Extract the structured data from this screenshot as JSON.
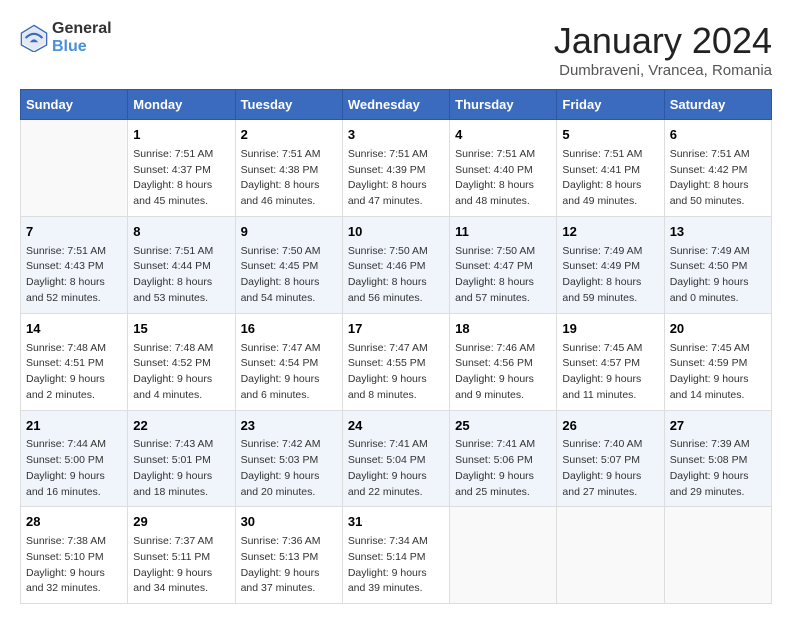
{
  "logo": {
    "text_general": "General",
    "text_blue": "Blue"
  },
  "title": "January 2024",
  "subtitle": "Dumbraveni, Vrancea, Romania",
  "days_of_week": [
    "Sunday",
    "Monday",
    "Tuesday",
    "Wednesday",
    "Thursday",
    "Friday",
    "Saturday"
  ],
  "weeks": [
    [
      {
        "day": "",
        "info": ""
      },
      {
        "day": "1",
        "info": "Sunrise: 7:51 AM\nSunset: 4:37 PM\nDaylight: 8 hours\nand 45 minutes."
      },
      {
        "day": "2",
        "info": "Sunrise: 7:51 AM\nSunset: 4:38 PM\nDaylight: 8 hours\nand 46 minutes."
      },
      {
        "day": "3",
        "info": "Sunrise: 7:51 AM\nSunset: 4:39 PM\nDaylight: 8 hours\nand 47 minutes."
      },
      {
        "day": "4",
        "info": "Sunrise: 7:51 AM\nSunset: 4:40 PM\nDaylight: 8 hours\nand 48 minutes."
      },
      {
        "day": "5",
        "info": "Sunrise: 7:51 AM\nSunset: 4:41 PM\nDaylight: 8 hours\nand 49 minutes."
      },
      {
        "day": "6",
        "info": "Sunrise: 7:51 AM\nSunset: 4:42 PM\nDaylight: 8 hours\nand 50 minutes."
      }
    ],
    [
      {
        "day": "7",
        "info": "Sunrise: 7:51 AM\nSunset: 4:43 PM\nDaylight: 8 hours\nand 52 minutes."
      },
      {
        "day": "8",
        "info": "Sunrise: 7:51 AM\nSunset: 4:44 PM\nDaylight: 8 hours\nand 53 minutes."
      },
      {
        "day": "9",
        "info": "Sunrise: 7:50 AM\nSunset: 4:45 PM\nDaylight: 8 hours\nand 54 minutes."
      },
      {
        "day": "10",
        "info": "Sunrise: 7:50 AM\nSunset: 4:46 PM\nDaylight: 8 hours\nand 56 minutes."
      },
      {
        "day": "11",
        "info": "Sunrise: 7:50 AM\nSunset: 4:47 PM\nDaylight: 8 hours\nand 57 minutes."
      },
      {
        "day": "12",
        "info": "Sunrise: 7:49 AM\nSunset: 4:49 PM\nDaylight: 8 hours\nand 59 minutes."
      },
      {
        "day": "13",
        "info": "Sunrise: 7:49 AM\nSunset: 4:50 PM\nDaylight: 9 hours\nand 0 minutes."
      }
    ],
    [
      {
        "day": "14",
        "info": "Sunrise: 7:48 AM\nSunset: 4:51 PM\nDaylight: 9 hours\nand 2 minutes."
      },
      {
        "day": "15",
        "info": "Sunrise: 7:48 AM\nSunset: 4:52 PM\nDaylight: 9 hours\nand 4 minutes."
      },
      {
        "day": "16",
        "info": "Sunrise: 7:47 AM\nSunset: 4:54 PM\nDaylight: 9 hours\nand 6 minutes."
      },
      {
        "day": "17",
        "info": "Sunrise: 7:47 AM\nSunset: 4:55 PM\nDaylight: 9 hours\nand 8 minutes."
      },
      {
        "day": "18",
        "info": "Sunrise: 7:46 AM\nSunset: 4:56 PM\nDaylight: 9 hours\nand 9 minutes."
      },
      {
        "day": "19",
        "info": "Sunrise: 7:45 AM\nSunset: 4:57 PM\nDaylight: 9 hours\nand 11 minutes."
      },
      {
        "day": "20",
        "info": "Sunrise: 7:45 AM\nSunset: 4:59 PM\nDaylight: 9 hours\nand 14 minutes."
      }
    ],
    [
      {
        "day": "21",
        "info": "Sunrise: 7:44 AM\nSunset: 5:00 PM\nDaylight: 9 hours\nand 16 minutes."
      },
      {
        "day": "22",
        "info": "Sunrise: 7:43 AM\nSunset: 5:01 PM\nDaylight: 9 hours\nand 18 minutes."
      },
      {
        "day": "23",
        "info": "Sunrise: 7:42 AM\nSunset: 5:03 PM\nDaylight: 9 hours\nand 20 minutes."
      },
      {
        "day": "24",
        "info": "Sunrise: 7:41 AM\nSunset: 5:04 PM\nDaylight: 9 hours\nand 22 minutes."
      },
      {
        "day": "25",
        "info": "Sunrise: 7:41 AM\nSunset: 5:06 PM\nDaylight: 9 hours\nand 25 minutes."
      },
      {
        "day": "26",
        "info": "Sunrise: 7:40 AM\nSunset: 5:07 PM\nDaylight: 9 hours\nand 27 minutes."
      },
      {
        "day": "27",
        "info": "Sunrise: 7:39 AM\nSunset: 5:08 PM\nDaylight: 9 hours\nand 29 minutes."
      }
    ],
    [
      {
        "day": "28",
        "info": "Sunrise: 7:38 AM\nSunset: 5:10 PM\nDaylight: 9 hours\nand 32 minutes."
      },
      {
        "day": "29",
        "info": "Sunrise: 7:37 AM\nSunset: 5:11 PM\nDaylight: 9 hours\nand 34 minutes."
      },
      {
        "day": "30",
        "info": "Sunrise: 7:36 AM\nSunset: 5:13 PM\nDaylight: 9 hours\nand 37 minutes."
      },
      {
        "day": "31",
        "info": "Sunrise: 7:34 AM\nSunset: 5:14 PM\nDaylight: 9 hours\nand 39 minutes."
      },
      {
        "day": "",
        "info": ""
      },
      {
        "day": "",
        "info": ""
      },
      {
        "day": "",
        "info": ""
      }
    ]
  ]
}
